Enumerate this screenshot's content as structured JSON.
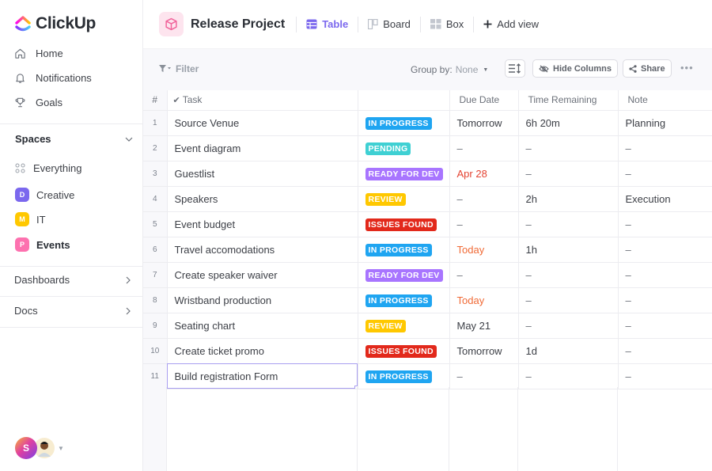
{
  "brand": {
    "name": "ClickUp"
  },
  "sidebar": {
    "nav": [
      {
        "label": "Home",
        "icon": "home-icon"
      },
      {
        "label": "Notifications",
        "icon": "bell-icon"
      },
      {
        "label": "Goals",
        "icon": "trophy-icon"
      }
    ],
    "spaces_label": "Spaces",
    "everything_label": "Everything",
    "spaces": [
      {
        "letter": "D",
        "label": "Creative",
        "color": "#7b68ee"
      },
      {
        "letter": "M",
        "label": "IT",
        "color": "#ffc800"
      },
      {
        "letter": "P",
        "label": "Events",
        "color": "#fd71af"
      }
    ],
    "dashboards_label": "Dashboards",
    "docs_label": "Docs",
    "user_initial": "S"
  },
  "header": {
    "project_title": "Release Project",
    "views": [
      {
        "label": "Table",
        "active": true
      },
      {
        "label": "Board",
        "active": false
      },
      {
        "label": "Box",
        "active": false
      }
    ],
    "add_view_label": "Add view"
  },
  "toolbar": {
    "filter_label": "Filter",
    "group_by_label": "Group by:",
    "group_by_value": "None",
    "hide_columns_label": "Hide Columns",
    "share_label": "Share"
  },
  "table": {
    "columns": {
      "num": "#",
      "task": "Task",
      "status": "",
      "due": "Due Date",
      "time": "Time Remaining",
      "note": "Note"
    },
    "rows": [
      {
        "n": "1",
        "task": "Source Venue",
        "status": "IN PROGRESS",
        "status_color": "#1fa5f1",
        "due": "Tomorrow",
        "due_tone": "",
        "time": "6h 20m",
        "note": "Planning"
      },
      {
        "n": "2",
        "task": "Event diagram",
        "status": "PENDING",
        "status_color": "#3fd0d3",
        "due": "–",
        "due_tone": "dash",
        "time": "–",
        "note": "–"
      },
      {
        "n": "3",
        "task": "Guestlist",
        "status": "READY FOR DEV",
        "status_color": "#a875ff",
        "due": "Apr 28",
        "due_tone": "red",
        "time": "–",
        "note": "–"
      },
      {
        "n": "4",
        "task": "Speakers",
        "status": "REVIEW",
        "status_color": "#ffc800",
        "due": "–",
        "due_tone": "dash",
        "time": "2h",
        "note": "Execution"
      },
      {
        "n": "5",
        "task": "Event budget",
        "status": "ISSUES FOUND",
        "status_color": "#e2291b",
        "due": "–",
        "due_tone": "dash",
        "time": "–",
        "note": "–"
      },
      {
        "n": "6",
        "task": "Travel accomodations",
        "status": "IN PROGRESS",
        "status_color": "#1fa5f1",
        "due": "Today",
        "due_tone": "orange",
        "time": "1h",
        "note": "–"
      },
      {
        "n": "7",
        "task": "Create speaker waiver",
        "status": "READY FOR DEV",
        "status_color": "#a875ff",
        "due": "–",
        "due_tone": "dash",
        "time": "–",
        "note": "–"
      },
      {
        "n": "8",
        "task": "Wristband production",
        "status": "IN PROGRESS",
        "status_color": "#1fa5f1",
        "due": "Today",
        "due_tone": "orange",
        "time": "–",
        "note": "–"
      },
      {
        "n": "9",
        "task": "Seating chart",
        "status": "REVIEW",
        "status_color": "#ffc800",
        "due": "May 21",
        "due_tone": "",
        "time": "–",
        "note": "–"
      },
      {
        "n": "10",
        "task": "Create ticket promo",
        "status": "ISSUES FOUND",
        "status_color": "#e2291b",
        "due": "Tomorrow",
        "due_tone": "",
        "time": "1d",
        "note": "–"
      },
      {
        "n": "11",
        "task": "Build registration Form",
        "status": "IN PROGRESS",
        "status_color": "#1fa5f1",
        "due": "–",
        "due_tone": "dash",
        "time": "–",
        "note": "–",
        "selected": true
      }
    ]
  }
}
